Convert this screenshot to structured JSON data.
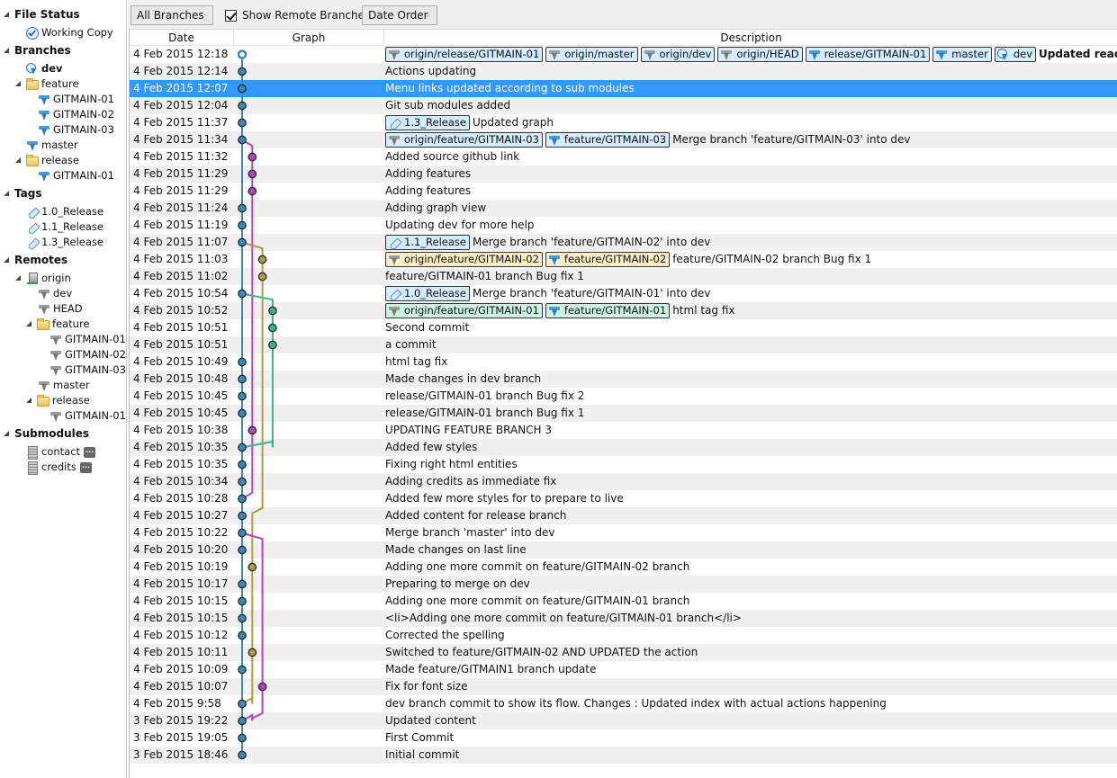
{
  "sidebar": {
    "file_status": {
      "label": "File Status",
      "items": [
        {
          "label": "Working Copy",
          "icon": "working-copy-check-icon"
        }
      ]
    },
    "branches": {
      "label": "Branches",
      "items": [
        {
          "label": "dev",
          "icon": "head-branch-icon",
          "current": true,
          "depth": 1
        },
        {
          "label": "feature",
          "icon": "folder-icon",
          "depth": 1,
          "expanded": true
        },
        {
          "label": "GITMAIN-01",
          "icon": "branch-icon",
          "depth": 2
        },
        {
          "label": "GITMAIN-02",
          "icon": "branch-icon",
          "depth": 2
        },
        {
          "label": "GITMAIN-03",
          "icon": "branch-icon",
          "depth": 2
        },
        {
          "label": "master",
          "icon": "branch-icon",
          "depth": 1
        },
        {
          "label": "release",
          "icon": "folder-icon",
          "depth": 1,
          "expanded": true
        },
        {
          "label": "GITMAIN-01",
          "icon": "branch-icon",
          "depth": 2
        }
      ]
    },
    "tags": {
      "label": "Tags",
      "items": [
        {
          "label": "1.0_Release"
        },
        {
          "label": "1.1_Release"
        },
        {
          "label": "1.3_Release"
        }
      ]
    },
    "remotes": {
      "label": "Remotes",
      "items": [
        {
          "label": "origin",
          "icon": "server-icon",
          "depth": 1
        },
        {
          "label": "dev",
          "icon": "remote-branch-icon",
          "depth": 2
        },
        {
          "label": "HEAD",
          "icon": "remote-branch-icon",
          "depth": 2
        },
        {
          "label": "feature",
          "icon": "folder-icon",
          "depth": 2
        },
        {
          "label": "GITMAIN-01",
          "icon": "remote-branch-icon",
          "depth": 3
        },
        {
          "label": "GITMAIN-02",
          "icon": "remote-branch-icon",
          "depth": 3
        },
        {
          "label": "GITMAIN-03",
          "icon": "remote-branch-icon",
          "depth": 3
        },
        {
          "label": "master",
          "icon": "remote-branch-icon",
          "depth": 2
        },
        {
          "label": "release",
          "icon": "folder-icon",
          "depth": 2
        },
        {
          "label": "GITMAIN-01",
          "icon": "remote-branch-icon",
          "depth": 3
        }
      ]
    },
    "submodules": {
      "label": "Submodules",
      "items": [
        {
          "label": "contact",
          "more": "..."
        },
        {
          "label": "credits",
          "more": "..."
        }
      ]
    }
  },
  "toolbar": {
    "branches_select": "All Branches",
    "show_remote_label": "Show Remote Branches",
    "show_remote_checked": true,
    "order_select": "Date Order"
  },
  "columns": {
    "date": "Date",
    "graph": "Graph",
    "description": "Description"
  },
  "colors": {
    "lane_blue": "#3d87b3",
    "lane_magenta": "#b546b8",
    "lane_gold": "#b59a45",
    "lane_green": "#3fb37f",
    "selected_row": "#3399ff"
  },
  "commits": [
    {
      "date": "4 Feb 2015 12:18",
      "lane": 0,
      "color": "blue",
      "head": true,
      "refs": [
        {
          "label": "origin/release/GITMAIN-01",
          "kind": "remote",
          "style": "blue"
        },
        {
          "label": "origin/master",
          "kind": "remote",
          "style": "blue"
        },
        {
          "label": "origin/dev",
          "kind": "remote",
          "style": "blue"
        },
        {
          "label": "origin/HEAD",
          "kind": "remote",
          "style": "blue"
        },
        {
          "label": "release/GITMAIN-01",
          "kind": "local",
          "style": "blue"
        },
        {
          "label": "master",
          "kind": "local",
          "style": "blue"
        },
        {
          "label": "dev",
          "kind": "head",
          "style": "blue"
        }
      ],
      "message": "Updated readme",
      "bold": true
    },
    {
      "date": "4 Feb 2015 12:14",
      "lane": 0,
      "color": "blue",
      "refs": [],
      "message": "Actions updating"
    },
    {
      "date": "4 Feb 2015 12:07",
      "lane": 0,
      "color": "blue",
      "refs": [],
      "message": "Menu links updated according to sub modules",
      "selected": true
    },
    {
      "date": "4 Feb 2015 12:04",
      "lane": 0,
      "color": "blue",
      "refs": [],
      "message": "Git sub modules added"
    },
    {
      "date": "4 Feb 2015 11:37",
      "lane": 0,
      "color": "blue",
      "refs": [
        {
          "label": "1.3_Release",
          "kind": "tag",
          "style": "blue"
        }
      ],
      "message": "Updated graph"
    },
    {
      "date": "4 Feb 2015 11:34",
      "lane": 0,
      "color": "blue",
      "refs": [
        {
          "label": "origin/feature/GITMAIN-03",
          "kind": "remote",
          "style": "blue"
        },
        {
          "label": "feature/GITMAIN-03",
          "kind": "local",
          "style": "blue"
        }
      ],
      "message": "Merge branch 'feature/GITMAIN-03' into dev"
    },
    {
      "date": "4 Feb 2015 11:32",
      "lane": 1,
      "color": "magenta",
      "refs": [],
      "message": "Added source github link"
    },
    {
      "date": "4 Feb 2015 11:29",
      "lane": 1,
      "color": "magenta",
      "refs": [],
      "message": "Adding features"
    },
    {
      "date": "4 Feb 2015 11:29",
      "lane": 1,
      "color": "magenta",
      "refs": [],
      "message": "Adding features"
    },
    {
      "date": "4 Feb 2015 11:24",
      "lane": 0,
      "color": "blue",
      "refs": [],
      "message": "Adding graph view"
    },
    {
      "date": "4 Feb 2015 11:19",
      "lane": 0,
      "color": "blue",
      "refs": [],
      "message": "Updating dev for more help"
    },
    {
      "date": "4 Feb 2015 11:07",
      "lane": 0,
      "color": "blue",
      "refs": [
        {
          "label": "1.1_Release",
          "kind": "tag",
          "style": "blue"
        }
      ],
      "message": "Merge branch 'feature/GITMAIN-02' into dev"
    },
    {
      "date": "4 Feb 2015 11:03",
      "lane": 2,
      "color": "gold",
      "refs": [
        {
          "label": "origin/feature/GITMAIN-02",
          "kind": "remote",
          "style": "yellow"
        },
        {
          "label": "feature/GITMAIN-02",
          "kind": "local",
          "style": "yellow"
        }
      ],
      "message": "feature/GITMAIN-02 branch Bug fix 1"
    },
    {
      "date": "4 Feb 2015 11:02",
      "lane": 2,
      "color": "gold",
      "refs": [],
      "message": "feature/GITMAIN-01 branch Bug fix 1"
    },
    {
      "date": "4 Feb 2015 10:54",
      "lane": 0,
      "color": "blue",
      "refs": [
        {
          "label": "1.0_Release",
          "kind": "tag",
          "style": "blue"
        }
      ],
      "message": "Merge branch 'feature/GITMAIN-01' into dev"
    },
    {
      "date": "4 Feb 2015 10:52",
      "lane": 3,
      "color": "green",
      "refs": [
        {
          "label": "origin/feature/GITMAIN-01",
          "kind": "remote",
          "style": "green"
        },
        {
          "label": "feature/GITMAIN-01",
          "kind": "local",
          "style": "green"
        }
      ],
      "message": "html tag fix"
    },
    {
      "date": "4 Feb 2015 10:51",
      "lane": 3,
      "color": "green",
      "refs": [],
      "message": "Second commit"
    },
    {
      "date": "4 Feb 2015 10:51",
      "lane": 3,
      "color": "green",
      "refs": [],
      "message": "a commit"
    },
    {
      "date": "4 Feb 2015 10:49",
      "lane": 0,
      "color": "blue",
      "refs": [],
      "message": "html tag fix"
    },
    {
      "date": "4 Feb 2015 10:48",
      "lane": 0,
      "color": "blue",
      "refs": [],
      "message": "Made changes in dev branch"
    },
    {
      "date": "4 Feb 2015 10:45",
      "lane": 0,
      "color": "blue",
      "refs": [],
      "message": "release/GITMAIN-01 branch Bug fix 2"
    },
    {
      "date": "4 Feb 2015 10:45",
      "lane": 0,
      "color": "blue",
      "refs": [],
      "message": "release/GITMAIN-01 branch Bug fix 1"
    },
    {
      "date": "4 Feb 2015 10:38",
      "lane": 1,
      "color": "magenta",
      "refs": [],
      "message": "UPDATING FEATURE BRANCH 3"
    },
    {
      "date": "4 Feb 2015 10:35",
      "lane": 0,
      "color": "blue",
      "refs": [],
      "message": "Added few styles"
    },
    {
      "date": "4 Feb 2015 10:35",
      "lane": 0,
      "color": "blue",
      "refs": [],
      "message": "Fixing right html entities"
    },
    {
      "date": "4 Feb 2015 10:34",
      "lane": 0,
      "color": "blue",
      "refs": [],
      "message": "Adding credits as immediate fix"
    },
    {
      "date": "4 Feb 2015 10:28",
      "lane": 0,
      "color": "blue",
      "refs": [],
      "message": "Added few more styles for to prepare to live"
    },
    {
      "date": "4 Feb 2015 10:27",
      "lane": 0,
      "color": "blue",
      "refs": [],
      "message": "Added content for release branch"
    },
    {
      "date": "4 Feb 2015 10:22",
      "lane": 0,
      "color": "blue",
      "refs": [],
      "message": "Merge branch 'master' into dev"
    },
    {
      "date": "4 Feb 2015 10:20",
      "lane": 0,
      "color": "blue",
      "refs": [],
      "message": "Made changes on last line"
    },
    {
      "date": "4 Feb 2015 10:19",
      "lane": 1,
      "color": "gold",
      "refs": [],
      "message": "Adding one more commit on feature/GITMAIN-02 branch"
    },
    {
      "date": "4 Feb 2015 10:17",
      "lane": 0,
      "color": "blue",
      "refs": [],
      "message": "Preparing to merge on dev"
    },
    {
      "date": "4 Feb 2015 10:15",
      "lane": 0,
      "color": "blue",
      "refs": [],
      "message": "Adding one more commit on feature/GITMAIN-01 branch"
    },
    {
      "date": "4 Feb 2015 10:15",
      "lane": 0,
      "color": "blue",
      "refs": [],
      "message": "<li>Adding one more commit on feature/GITMAIN-01 branch</li>"
    },
    {
      "date": "4 Feb 2015 10:12",
      "lane": 0,
      "color": "blue",
      "refs": [],
      "message": "Corrected the spelling"
    },
    {
      "date": "4 Feb 2015 10:11",
      "lane": 1,
      "color": "gold",
      "refs": [],
      "message": "Switched to feature/GITMAIN-02 AND UPDATED the action"
    },
    {
      "date": "4 Feb 2015 10:09",
      "lane": 0,
      "color": "blue",
      "refs": [],
      "message": "Made feature/GITMAIN1 branch update"
    },
    {
      "date": "4 Feb 2015 10:07",
      "lane": 2,
      "color": "magenta",
      "refs": [],
      "message": "Fix for font size"
    },
    {
      "date": "4 Feb 2015 9:58",
      "lane": 0,
      "color": "blue",
      "refs": [],
      "message": "dev branch commit to show its flow. Changes : Updated index with actual actions happening"
    },
    {
      "date": "3 Feb 2015 19:22",
      "lane": 0,
      "color": "blue",
      "refs": [],
      "message": "Updated content"
    },
    {
      "date": "3 Feb 2015 19:05",
      "lane": 0,
      "color": "blue",
      "refs": [],
      "message": "First Commit"
    },
    {
      "date": "3 Feb 2015 18:46",
      "lane": 0,
      "color": "blue",
      "refs": [],
      "message": "Initial commit"
    }
  ],
  "graph_edges": [
    {
      "from": 0,
      "to": 41,
      "from_lane": 0,
      "to_lane": 0,
      "color": "blue"
    },
    {
      "from": 5,
      "to": 6,
      "from_lane": 0,
      "to_lane": 1,
      "color": "magenta"
    },
    {
      "from": 6,
      "to": 22,
      "from_lane": 1,
      "to_lane": 1,
      "color": "magenta"
    },
    {
      "from": 22,
      "to": 26,
      "from_lane": 1,
      "to_lane": 0,
      "color": "magenta",
      "merge": true
    },
    {
      "from": 11,
      "to": 12,
      "from_lane": 0,
      "to_lane": 2,
      "color": "gold"
    },
    {
      "from": 12,
      "to": 26,
      "from_lane": 2,
      "to_lane": 2,
      "color": "gold"
    },
    {
      "from": 26,
      "to": 27,
      "from_lane": 2,
      "to_lane": 1,
      "color": "gold",
      "shift": true
    },
    {
      "from": 27,
      "to": 38,
      "from_lane": 1,
      "to_lane": 1,
      "color": "gold"
    },
    {
      "from": 38,
      "to": 38,
      "from_lane": 1,
      "to_lane": 0,
      "color": "gold",
      "merge": true
    },
    {
      "from": 14,
      "to": 15,
      "from_lane": 0,
      "to_lane": 3,
      "color": "green"
    },
    {
      "from": 15,
      "to": 23,
      "from_lane": 3,
      "to_lane": 3,
      "color": "green"
    },
    {
      "from": 23,
      "to": 23,
      "from_lane": 3,
      "to_lane": 0,
      "color": "green",
      "merge": true
    },
    {
      "from": 28,
      "to": 29,
      "from_lane": 0,
      "to_lane": 2,
      "color": "magenta"
    },
    {
      "from": 29,
      "to": 38,
      "from_lane": 2,
      "to_lane": 2,
      "color": "magenta"
    },
    {
      "from": 38,
      "to": 39,
      "from_lane": 2,
      "to_lane": 1,
      "color": "magenta",
      "shift": true
    },
    {
      "from": 39,
      "to": 39,
      "from_lane": 1,
      "to_lane": 0,
      "color": "magenta",
      "merge": true
    }
  ]
}
